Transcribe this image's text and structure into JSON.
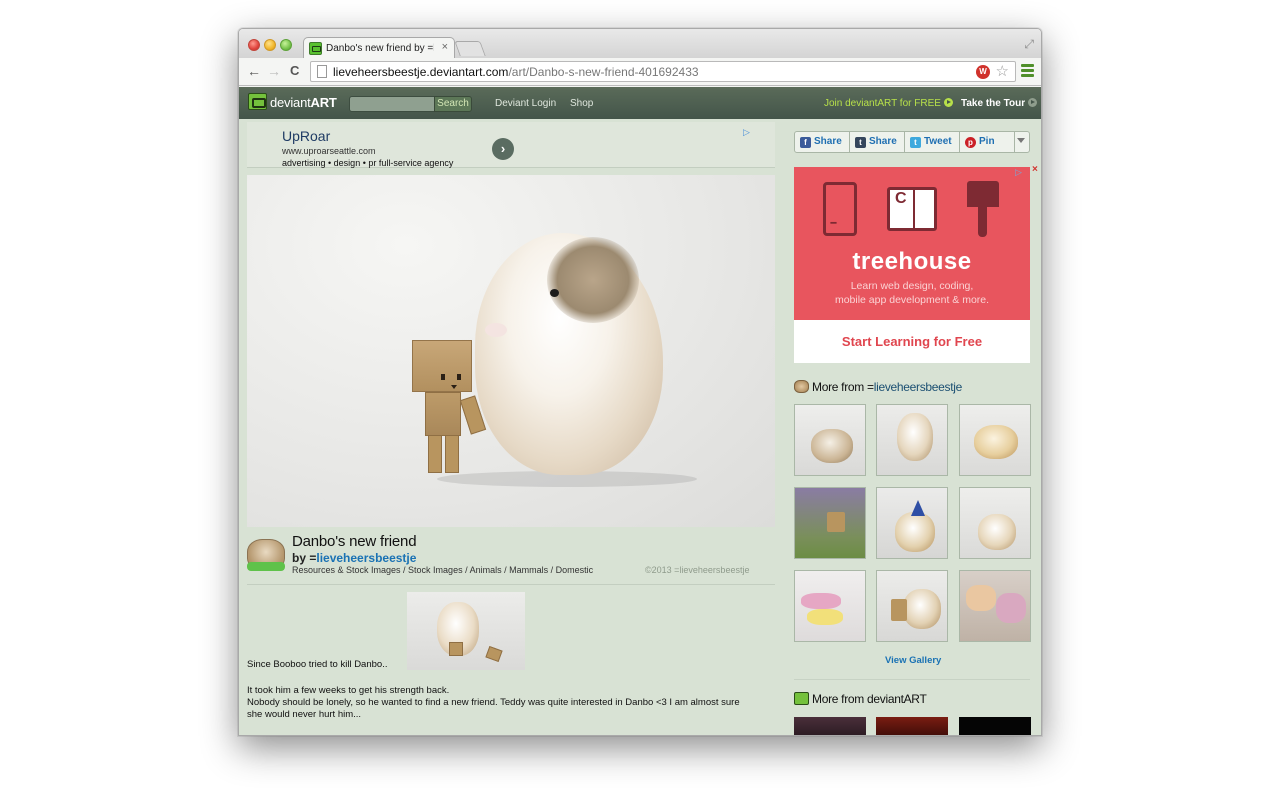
{
  "browser": {
    "tab_title": "Danbo's new friend by =lie",
    "tab_close": "×",
    "url_host": "lieveheersbeestje.deviantart.com",
    "url_path": "/art/Danbo-s-new-friend-401692433",
    "back": "←",
    "forward": "→",
    "reload": "C",
    "star": "☆",
    "fullscreen": "⤢"
  },
  "da_header": {
    "logo_prefix": "deviant",
    "logo_suffix": "ART",
    "search_button": "Search",
    "search_placeholder": "",
    "login": "Deviant Login",
    "shop": "Shop",
    "join": "Join deviantART for FREE",
    "tour": "Take the Tour"
  },
  "top_ad": {
    "title": "UpRoar",
    "url": "www.uproarseattle.com",
    "description": "advertising • design • pr full-service agency",
    "go": "›",
    "choices": "▷"
  },
  "artwork": {
    "title": "Danbo's new friend",
    "by_prefix": "by =",
    "artist": "lieveheersbeestje",
    "categories": "Resources & Stock Images / Stock Images / Animals / Mammals / Domestic",
    "copyright": "©2013 =lieveheersbeestje",
    "caption": "Since Booboo tried to kill Danbo..",
    "paragraph1": "It took him a few weeks to get his strength back.",
    "paragraph2": "Nobody should be lonely, so he wanted to find a new friend. Teddy was quite interested in Danbo <3 I am almost sure she would never hurt him..."
  },
  "share": {
    "facebook": "Share",
    "tumblr": "Share",
    "twitter": "Tweet",
    "pinterest": "Pin",
    "facebook_icon": "f",
    "tumblr_icon": "t",
    "twitter_icon": "t",
    "pinterest_icon": "p"
  },
  "side_ad": {
    "logo": "treehouse",
    "tagline1": "Learn web design, coding,",
    "tagline2": "mobile app development & more.",
    "cta": "Start Learning for Free",
    "adchoice": "▷",
    "close": "×"
  },
  "more_from_artist": {
    "prefix": "More from =",
    "artist": "lieveheersbeestje",
    "view_gallery": "View Gallery"
  },
  "more_from_da": {
    "label": "More from deviantART"
  },
  "colors": {
    "page_bg": "#d8e2d4",
    "header_bg": "#44554a",
    "link_blue": "#1a72b4",
    "accent_green": "#b7e04a",
    "ad_red": "#e8555e"
  }
}
